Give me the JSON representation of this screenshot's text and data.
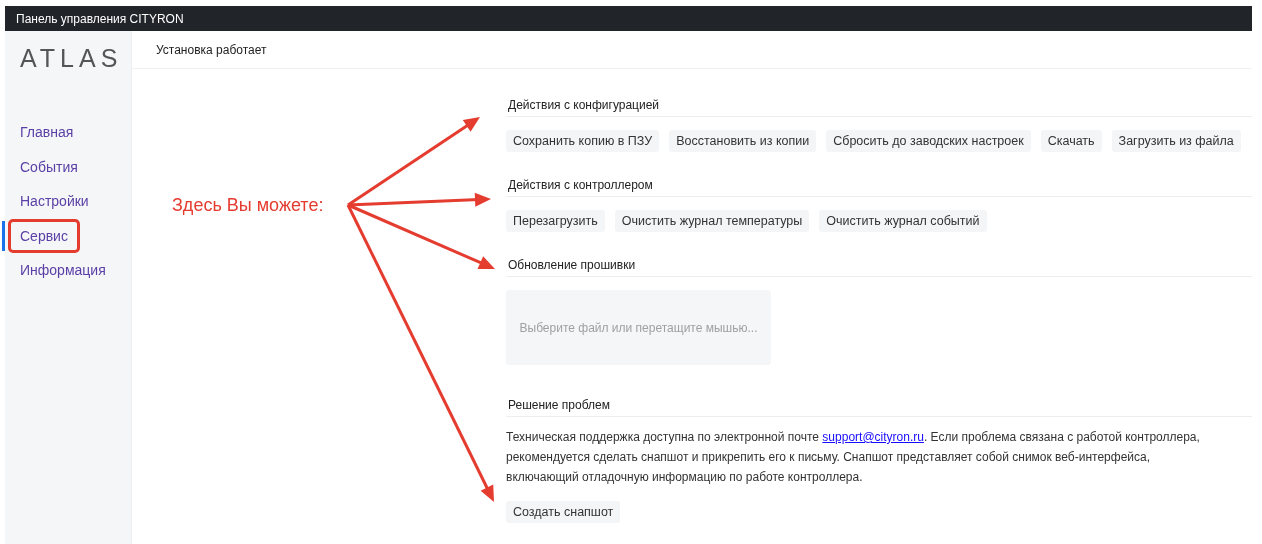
{
  "window": {
    "title": "Панель управления CITYRON"
  },
  "sidebar": {
    "logo": "ATLAS",
    "items": [
      {
        "label": "Главная",
        "selected": false,
        "highlighted": false
      },
      {
        "label": "События",
        "selected": false,
        "highlighted": false
      },
      {
        "label": "Настройки",
        "selected": false,
        "highlighted": false
      },
      {
        "label": "Сервис",
        "selected": true,
        "highlighted": true
      },
      {
        "label": "Информация",
        "selected": false,
        "highlighted": false
      }
    ]
  },
  "status": "Установка работает",
  "sections": [
    {
      "kind": "buttons",
      "title": "Действия с конфигурацией",
      "buttons": [
        "Сохранить копию в ПЗУ",
        "Восстановить из копии",
        "Сбросить до заводских настроек",
        "Скачать",
        "Загрузить из файла"
      ]
    },
    {
      "kind": "buttons",
      "title": "Действия с контроллером",
      "buttons": [
        "Перезагрузить",
        "Очистить журнал температуры",
        "Очистить журнал событий"
      ]
    },
    {
      "kind": "upload",
      "title": "Обновление прошивки",
      "placeholder": "Выберите файл или перетащите мышью..."
    },
    {
      "kind": "support",
      "title": "Решение проблем",
      "text_before": "Техническая поддержка доступна по электронной почте ",
      "link": "support@cityron.ru",
      "text_after": ". Если проблема связана с работой контроллера, рекомендуется сделать снапшот и прикрепить его к письму. Снапшот представляет собой снимок веб-интерфейса, включающий отладочную информацию по работе контроллера.",
      "buttons": [
        "Создать снапшот"
      ]
    }
  ],
  "annotation": {
    "text": "Здесь Вы можете:"
  }
}
